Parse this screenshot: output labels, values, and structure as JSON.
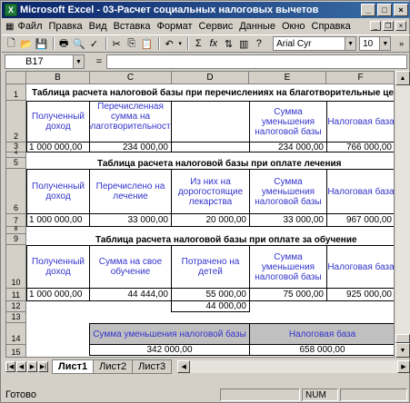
{
  "window": {
    "title": "Microsoft Excel - 03-Расчет социальных налоговых вычетов",
    "icon": "excel-icon",
    "buttons": [
      "_",
      "□",
      "×"
    ]
  },
  "menu": [
    "Файл",
    "Правка",
    "Вид",
    "Вставка",
    "Формат",
    "Сервис",
    "Данные",
    "Окно",
    "Справка"
  ],
  "toolbar": {
    "font": "Arial Cyr",
    "size": "10",
    "sigma": "Σ",
    "fx": "fx"
  },
  "formula_bar": {
    "cell_ref": "B17",
    "equals": "="
  },
  "grid": {
    "columns": [
      "B",
      "C",
      "D",
      "E",
      "F"
    ],
    "rows": [
      "1",
      "2",
      "3",
      "4",
      "5",
      "6",
      "7",
      "8",
      "9",
      "10",
      "11",
      "12",
      "13",
      "14",
      "15"
    ],
    "title1": "Таблица расчета налоговой базы при перечислениях на благотворительные цели",
    "t1_headers": [
      "Полученный доход",
      "Перечисленная сумма на благотворительность",
      "",
      "Сумма уменьшения налоговой базы",
      "Налоговая база"
    ],
    "t1_values": [
      "1 000 000,00",
      "234 000,00",
      "",
      "234 000,00",
      "766 000,00"
    ],
    "title2": "Таблица расчета налоговой базы при оплате лечения",
    "t2_headers": [
      "Полученный доход",
      "Перечислено на лечение",
      "Из них на дорогостоящие лекарства",
      "Сумма уменьшения налоговой базы",
      "Налоговая база"
    ],
    "t2_values": [
      "1 000 000,00",
      "33 000,00",
      "20 000,00",
      "33 000,00",
      "967 000,00"
    ],
    "title3": "Таблица расчета налоговой базы при оплате за обучение",
    "t3_headers": [
      "Полученный доход",
      "Сумма на свое обучение",
      "Потрачено на детей",
      "Сумма уменьшения налоговой базы",
      "Налоговая база"
    ],
    "t3_values": [
      "1 000 000,00",
      "44 444,00",
      "55 000,00",
      "75 000,00",
      "925 000,00"
    ],
    "t3_extra": "44 000,00",
    "summary_headers": [
      "Сумма уменьшения налоговой базы",
      "Налоговая база"
    ],
    "summary_values": [
      "342 000,00",
      "658 000,00"
    ]
  },
  "sheets": [
    "Лист1",
    "Лист2",
    "Лист3"
  ],
  "status": {
    "ready": "Готово",
    "num": "NUM"
  }
}
